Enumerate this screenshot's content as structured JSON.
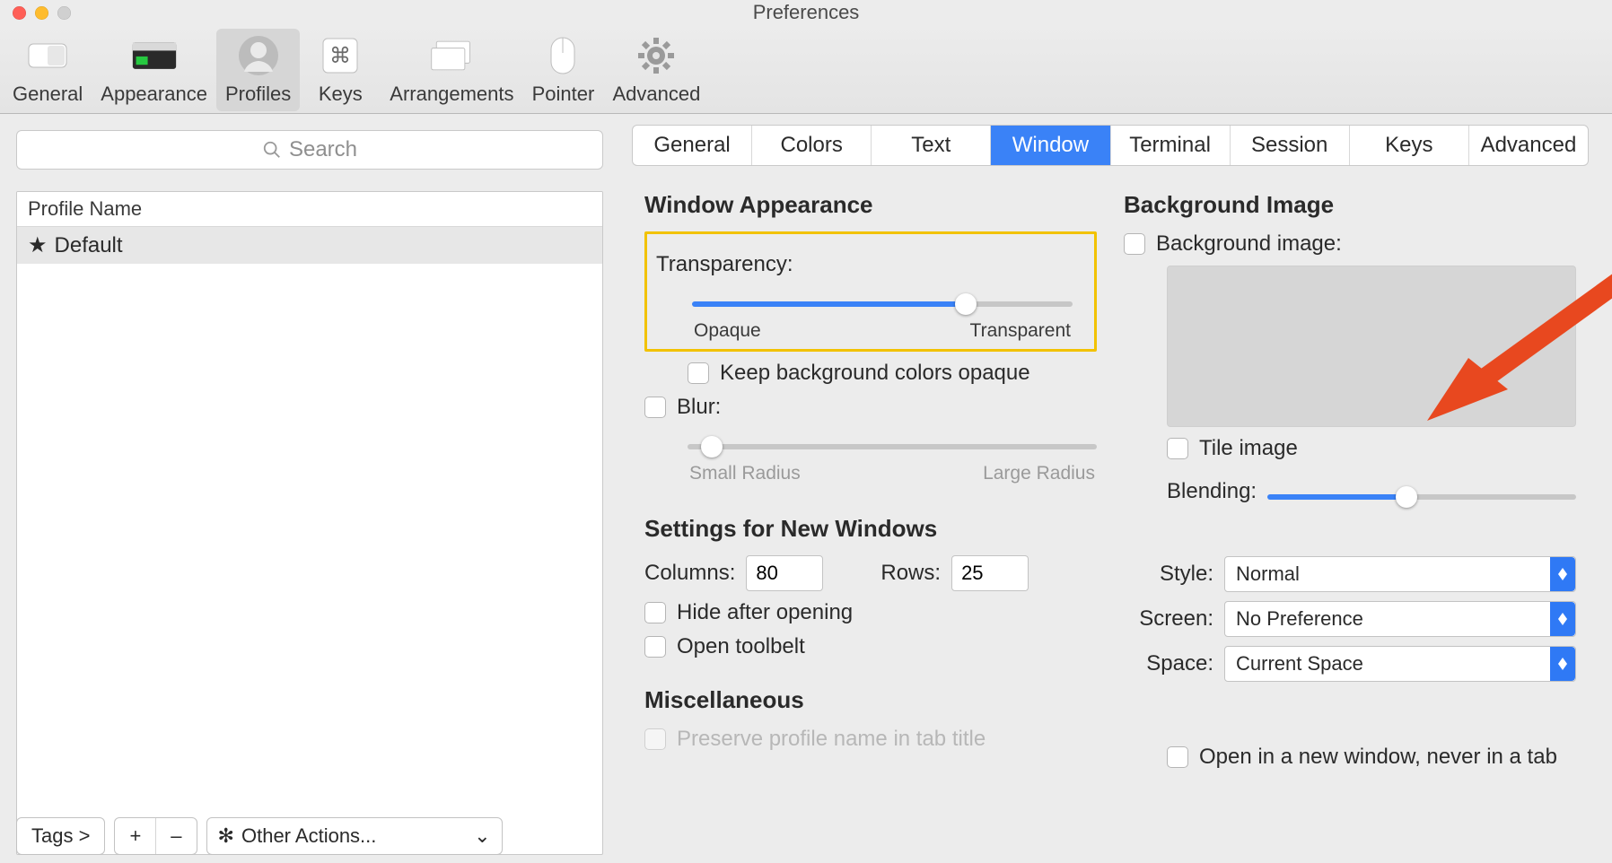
{
  "window": {
    "title": "Preferences"
  },
  "toolbar": {
    "items": [
      {
        "label": "General"
      },
      {
        "label": "Appearance"
      },
      {
        "label": "Profiles"
      },
      {
        "label": "Keys"
      },
      {
        "label": "Arrangements"
      },
      {
        "label": "Pointer"
      },
      {
        "label": "Advanced"
      }
    ],
    "selected": "Profiles"
  },
  "sidebar": {
    "search_placeholder": "Search",
    "header": "Profile Name",
    "rows": [
      {
        "star": "★",
        "name": "Default"
      }
    ],
    "footer": {
      "tags_label": "Tags >",
      "plus": "+",
      "minus": "–",
      "other_actions": "Other Actions..."
    }
  },
  "tabs": {
    "items": [
      "General",
      "Colors",
      "Text",
      "Window",
      "Terminal",
      "Session",
      "Keys",
      "Advanced"
    ],
    "active": "Window"
  },
  "left_col": {
    "section_appearance": "Window Appearance",
    "transparency_label": "Transparency:",
    "transparency_min": "Opaque",
    "transparency_max": "Transparent",
    "transparency_value": 72,
    "keep_bg_opaque": "Keep background colors opaque",
    "blur_label": "Blur:",
    "blur_min": "Small Radius",
    "blur_max": "Large Radius",
    "blur_value": 6,
    "section_newwin": "Settings for New Windows",
    "columns_label": "Columns:",
    "columns_value": "80",
    "rows_label": "Rows:",
    "rows_value": "25",
    "hide_after_open": "Hide after opening",
    "open_toolbelt": "Open toolbelt",
    "section_misc": "Miscellaneous",
    "preserve_profile": "Preserve profile name in tab title"
  },
  "right_col": {
    "section_bg": "Background Image",
    "bg_image_label": "Background image:",
    "tile_label": "Tile image",
    "blending_label": "Blending:",
    "blending_value": 45,
    "style_label": "Style:",
    "style_value": "Normal",
    "screen_label": "Screen:",
    "screen_value": "No Preference",
    "space_label": "Space:",
    "space_value": "Current Space",
    "open_new_win": "Open in a new window, never in a tab"
  }
}
